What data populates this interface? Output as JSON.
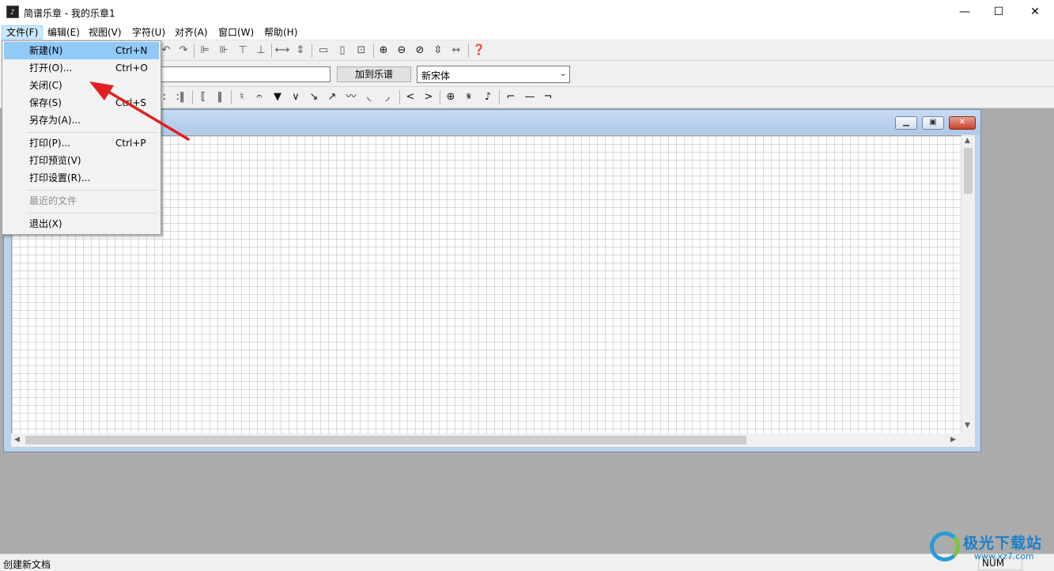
{
  "window": {
    "title": "简谱乐章 - 我的乐章1",
    "icon_name": "app-logo-icon",
    "minimize_glyph": "—",
    "maximize_glyph": "☐",
    "close_glyph": "✕"
  },
  "menubar": {
    "items": [
      {
        "label": "文件(F)"
      },
      {
        "label": "编辑(E)"
      },
      {
        "label": "视图(V)"
      },
      {
        "label": "字符(U)"
      },
      {
        "label": "对齐(A)"
      },
      {
        "label": "窗口(W)"
      },
      {
        "label": "帮助(H)"
      }
    ]
  },
  "toolbar2": {
    "add_button_label": "加到乐谱",
    "text_input_value": "",
    "font_select_value": "新宋体"
  },
  "file_menu": {
    "items": [
      {
        "label": "新建(N)",
        "shortcut": "Ctrl+N"
      },
      {
        "label": "打开(O)...",
        "shortcut": "Ctrl+O"
      },
      {
        "label": "关闭(C)",
        "shortcut": ""
      },
      {
        "label": "保存(S)",
        "shortcut": "Ctrl+S"
      },
      {
        "label": "另存为(A)...",
        "shortcut": ""
      },
      {
        "label": "打印(P)...",
        "shortcut": "Ctrl+P"
      },
      {
        "label": "打印预览(V)",
        "shortcut": ""
      },
      {
        "label": "打印设置(R)...",
        "shortcut": ""
      },
      {
        "label": "最近的文件",
        "shortcut": ""
      },
      {
        "label": "退出(X)",
        "shortcut": ""
      }
    ]
  },
  "statusbar": {
    "message": "创建新文档",
    "num_indicator": "NUM"
  },
  "watermark": {
    "name": "极光下载站",
    "url": "www.xz7.com"
  },
  "colors": {
    "menu_highlight": "#91c9f7",
    "annotation_arrow": "#e02020"
  }
}
